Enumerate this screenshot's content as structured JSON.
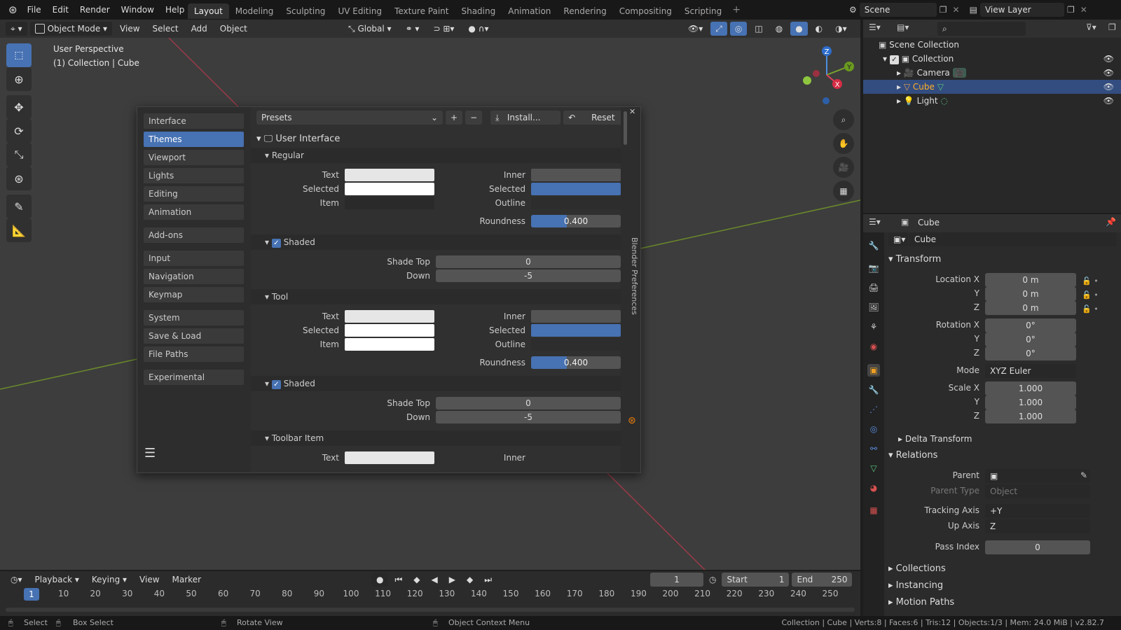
{
  "topbar": {
    "menus": [
      "File",
      "Edit",
      "Render",
      "Window",
      "Help"
    ],
    "workspaces": [
      "Layout",
      "Modeling",
      "Sculpting",
      "UV Editing",
      "Texture Paint",
      "Shading",
      "Animation",
      "Rendering",
      "Compositing",
      "Scripting"
    ],
    "active_workspace": "Layout",
    "scene": "Scene",
    "view_layer": "View Layer"
  },
  "viewport": {
    "mode": "Object Mode",
    "menus": [
      "View",
      "Select",
      "Add",
      "Object"
    ],
    "orientation": "Global",
    "info_line1": "User Perspective",
    "info_line2": "(1) Collection | Cube",
    "gizmo": {
      "x": "X",
      "y": "Y",
      "z": "Z"
    }
  },
  "prefs": {
    "title": "Blender Preferences",
    "sidebar": [
      "Interface",
      "Themes",
      "Viewport",
      "Lights",
      "Editing",
      "Animation",
      "Add-ons",
      "Input",
      "Navigation",
      "Keymap",
      "System",
      "Save & Load",
      "File Paths",
      "Experimental"
    ],
    "active": "Themes",
    "presets": "Presets",
    "install": "Install...",
    "reset": "Reset",
    "section": "User Interface",
    "regular": {
      "title": "Regular",
      "text": "Text",
      "selected": "Selected",
      "item": "Item",
      "inner": "Inner",
      "outline": "Outline",
      "roundness_label": "Roundness",
      "roundness": "0.400",
      "roundness_value": 0.4,
      "shaded": "Shaded",
      "shade_top_label": "Shade Top",
      "shade_top": "0",
      "down_label": "Down",
      "down": "-5"
    },
    "tool": {
      "title": "Tool",
      "text": "Text",
      "selected": "Selected",
      "item": "Item",
      "inner": "Inner",
      "outline": "Outline",
      "roundness_label": "Roundness",
      "roundness": "0.400",
      "roundness_value": 0.4,
      "shaded": "Shaded",
      "shade_top_label": "Shade Top",
      "shade_top": "0",
      "down_label": "Down",
      "down": "-5"
    },
    "toolbar_item": {
      "title": "Toolbar Item",
      "text": "Text",
      "inner": "Inner"
    }
  },
  "outliner": {
    "root": "Scene Collection",
    "collection": "Collection",
    "items": [
      "Camera",
      "Cube",
      "Light"
    ],
    "selected": "Cube"
  },
  "properties": {
    "object_name": "Cube",
    "data_name": "Cube",
    "transform": "Transform",
    "location_label": "Location X",
    "rotation_label": "Rotation X",
    "scale_label": "Scale X",
    "axis_y": "Y",
    "axis_z": "Z",
    "location": [
      "0 m",
      "0 m",
      "0 m"
    ],
    "rotation": [
      "0°",
      "0°",
      "0°"
    ],
    "mode_label": "Mode",
    "mode": "XYZ Euler",
    "scale": [
      "1.000",
      "1.000",
      "1.000"
    ],
    "delta": "Delta Transform",
    "relations": "Relations",
    "parent_label": "Parent",
    "parent_type_label": "Parent Type",
    "parent_type": "Object",
    "tracking_label": "Tracking Axis",
    "tracking": "+Y",
    "up_label": "Up Axis",
    "up": "Z",
    "pass_label": "Pass Index",
    "pass": "0",
    "collections": "Collections",
    "instancing": "Instancing",
    "motion_paths": "Motion Paths"
  },
  "timeline": {
    "menus": [
      "Playback",
      "Keying",
      "View",
      "Marker"
    ],
    "current": "1",
    "start_label": "Start",
    "start": "1",
    "end_label": "End",
    "end": "250",
    "ticks": [
      "10",
      "20",
      "30",
      "40",
      "50",
      "60",
      "70",
      "80",
      "90",
      "100",
      "110",
      "120",
      "130",
      "140",
      "150",
      "160",
      "170",
      "180",
      "190",
      "200",
      "210",
      "220",
      "230",
      "240",
      "250"
    ],
    "playhead": "1"
  },
  "status": {
    "select": "Select",
    "box_select": "Box Select",
    "rotate": "Rotate View",
    "context": "Object Context Menu",
    "info": "Collection | Cube | Verts:8 | Faces:6 | Tris:12 | Objects:1/3 | Mem: 24.0 MiB | v2.82.7"
  },
  "colors": {
    "accent": "#4772b3",
    "selected_row": "#334d80",
    "bg": "#3d3d3d"
  }
}
